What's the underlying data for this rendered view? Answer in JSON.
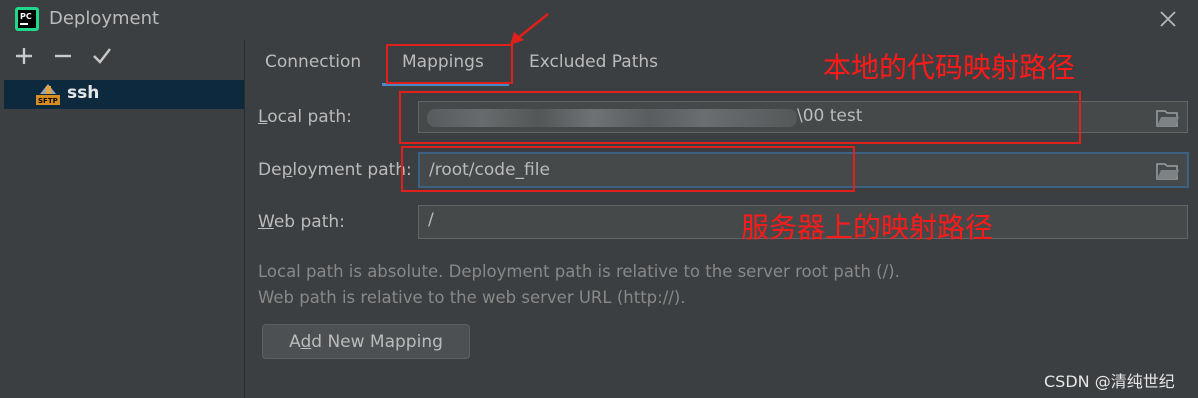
{
  "window": {
    "title": "Deployment",
    "app_icon": "pycharm-icon"
  },
  "sidebar": {
    "toolbar": [
      {
        "name": "add",
        "glyph": "+"
      },
      {
        "name": "remove",
        "glyph": "−"
      },
      {
        "name": "apply",
        "glyph": "✔"
      }
    ],
    "servers": [
      {
        "label": "ssh",
        "icon": "sftp-icon"
      }
    ]
  },
  "tabs": [
    {
      "label": "Connection",
      "active": false
    },
    {
      "label": "Mappings",
      "active": true
    },
    {
      "label": "Excluded Paths",
      "active": false
    }
  ],
  "mappings": {
    "local_path": {
      "label_mnemonic": "L",
      "label_rest": "ocal path:",
      "value_visible_suffix": "\\00 test"
    },
    "deployment_path": {
      "label_pre": "De",
      "label_mnemonic": "p",
      "label_rest": "loyment path:",
      "value": "/root/code_file"
    },
    "web_path": {
      "label_mnemonic": "W",
      "label_rest": "eb path:",
      "value": "/"
    },
    "help_line_1": "Local path is absolute. Deployment path is relative to the server root path (/).",
    "help_line_2": "Web path is relative to the web server URL (http://).",
    "add_button": {
      "pre": "A",
      "mnemonic": "d",
      "rest": "d New Mapping"
    }
  },
  "annotations": {
    "local_note": "本地的代码映射路径",
    "server_note": "服务器上的映射路径",
    "color": "#ff1a1a"
  },
  "watermark": "CSDN @清纯世纪",
  "colors": {
    "background": "#3c3f41",
    "selection": "#0d293e",
    "tab_underline": "#4a88c7",
    "focus_border": "#3d6185"
  }
}
